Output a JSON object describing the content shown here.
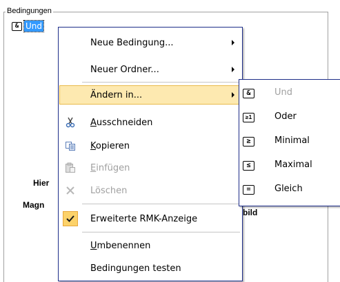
{
  "panel": {
    "group_title": "Bedingungen",
    "tree_node": {
      "icon_symbol": "&",
      "label": "Und"
    },
    "background_labels": [
      "Hier",
      "Magn",
      "bild"
    ]
  },
  "context_menu": {
    "items": [
      {
        "label": "Neue Bedingung...",
        "submenu": true
      },
      {
        "label": "Neuer Ordner...",
        "submenu": true
      },
      {
        "label": "Ändern in...",
        "submenu": true,
        "highlighted": true
      },
      {
        "label": "Ausschneiden",
        "mnemonic": "A",
        "icon": "scissors-icon"
      },
      {
        "label": "Kopieren",
        "mnemonic": "K",
        "icon": "copy-icon"
      },
      {
        "label": "Einfügen",
        "mnemonic": "E",
        "icon": "paste-icon",
        "disabled": true
      },
      {
        "label": "Löschen",
        "icon": "delete-icon",
        "disabled": true
      },
      {
        "label": "Erweiterte RMK-Anzeige",
        "checked": true,
        "icon": "checkmark-icon"
      },
      {
        "label": "Umbenennen",
        "mnemonic": "U"
      },
      {
        "label": "Bedingungen testen"
      }
    ]
  },
  "submenu": {
    "items": [
      {
        "label": "Und",
        "symbol": "&",
        "disabled": true
      },
      {
        "label": "Oder",
        "symbol": "≥1"
      },
      {
        "label": "Minimal",
        "symbol": "≥"
      },
      {
        "label": "Maximal",
        "symbol": "≤"
      },
      {
        "label": "Gleich",
        "symbol": "="
      }
    ]
  },
  "colors": {
    "menu_border": "#1c2c88",
    "highlight_fill": "#fde9b0",
    "highlight_border": "#e8b94a",
    "selection": "#3399ff",
    "disabled_text": "#a0a0a0"
  }
}
